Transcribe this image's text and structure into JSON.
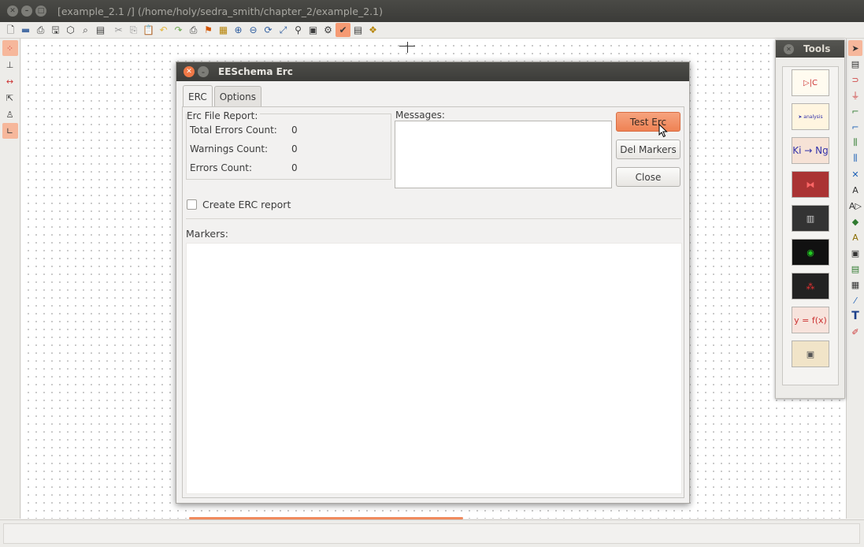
{
  "window": {
    "title": "[example_2.1 /] (/home/holy/sedra_smith/chapter_2/example_2.1)"
  },
  "toolbar_top": {
    "icons": [
      "new-sheet-icon",
      "open-icon",
      "save-icon",
      "page-settings-icon",
      "print-plot-icon",
      "copy-icon",
      "undo-icon",
      "redo-icon",
      "find-icon",
      "zoom-in-icon",
      "zoom-out-icon",
      "zoom-redraw-icon",
      "zoom-fit-icon",
      "hierarchy-icon",
      "erc-icon",
      "netlist-icon",
      "bom-icon",
      "library-icon",
      "cvpcb-icon",
      "pcbnew-icon"
    ]
  },
  "tools_palette": {
    "title": "Tools",
    "items": [
      "eeschema",
      "spice-analysis",
      "ki-to-ng",
      "cvpcb",
      "pcb-3d",
      "pcbnew",
      "gerbview",
      "function-plot",
      "footprint-editor"
    ],
    "labels": {
      "kiNg": "Ki → Ng",
      "fx": "y = f(x)",
      "analysis": "➤ analysis"
    }
  },
  "dialog": {
    "title": "EESchema Erc",
    "tabs": [
      "ERC",
      "Options"
    ],
    "report": {
      "group_title": "Erc File Report:",
      "total_errors_label": "Total Errors Count:",
      "total_errors_value": "0",
      "warnings_label": "Warnings Count:",
      "warnings_value": "0",
      "errors_label": "Errors Count:",
      "errors_value": "0"
    },
    "messages_label": "Messages:",
    "buttons": {
      "test_erc": "Test Erc",
      "del_markers": "Del Markers",
      "close": "Close"
    },
    "create_report_label": "Create ERC report",
    "markers_label": "Markers:"
  },
  "colors": {
    "accent": "#ef8254",
    "titlebar": "#3c3c39"
  }
}
